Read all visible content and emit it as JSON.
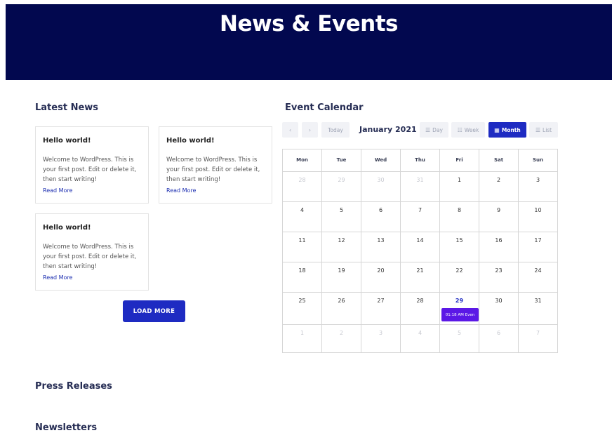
{
  "hero": {
    "title": "News & Events"
  },
  "latest_news": {
    "heading": "Latest News",
    "posts": [
      {
        "title": "Hello world!",
        "excerpt": "Welcome to WordPress. This is your first post. Edit or delete it, then start writing!",
        "read_more": "Read More"
      },
      {
        "title": "Hello world!",
        "excerpt": "Welcome to WordPress. This is your first post. Edit or delete it, then start writing!",
        "read_more": "Read More"
      },
      {
        "title": "Hello world!",
        "excerpt": "Welcome to WordPress. This is your first post. Edit or delete it, then start writing!",
        "read_more": "Read More"
      }
    ],
    "load_more": "LOAD MORE"
  },
  "calendar": {
    "heading": "Event Calendar",
    "prev": "‹",
    "next": "›",
    "today": "Today",
    "month_title": "January 2021",
    "views": {
      "day": "Day",
      "week": "Week",
      "month": "Month",
      "list": "List"
    },
    "weekdays": [
      "Mon",
      "Tue",
      "Wed",
      "Thu",
      "Fri",
      "Sat",
      "Sun"
    ],
    "weeks": [
      [
        "28",
        "29",
        "30",
        "31",
        "1",
        "2",
        "3"
      ],
      [
        "4",
        "5",
        "6",
        "7",
        "8",
        "9",
        "10"
      ],
      [
        "11",
        "12",
        "13",
        "14",
        "15",
        "16",
        "17"
      ],
      [
        "18",
        "19",
        "20",
        "21",
        "22",
        "23",
        "24"
      ],
      [
        "25",
        "26",
        "27",
        "28",
        "29",
        "30",
        "31"
      ],
      [
        "1",
        "2",
        "3",
        "4",
        "5",
        "6",
        "7"
      ]
    ],
    "event": {
      "label": "01:18 AM Even"
    },
    "accent_color": "#1e2bc2",
    "event_color": "#5b18e6"
  },
  "press_releases": {
    "heading": "Press Releases"
  },
  "newsletters": {
    "heading": "Newsletters"
  }
}
